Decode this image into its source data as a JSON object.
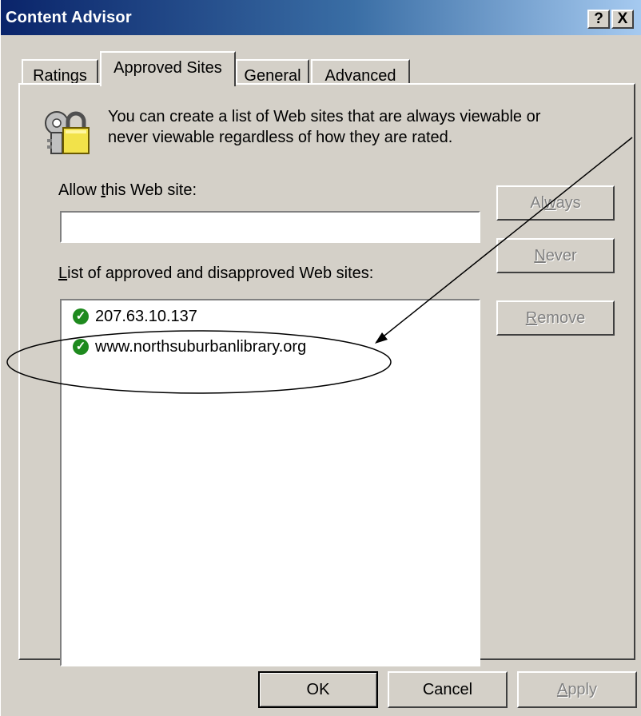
{
  "window": {
    "title": "Content Advisor",
    "help_button": "?",
    "close_button": "X"
  },
  "tabs": [
    {
      "label": "Ratings",
      "selected": false
    },
    {
      "label": "Approved Sites",
      "selected": true
    },
    {
      "label": "General",
      "selected": false
    },
    {
      "label": "Advanced",
      "selected": false
    }
  ],
  "approved": {
    "info_line1": "You can create a list of Web sites that are always viewable or",
    "info_line2": "never viewable regardless of how they are rated.",
    "allow_label_pre": "Allow ",
    "allow_label_key": "t",
    "allow_label_post": "his Web site:",
    "allow_input_value": "",
    "list_label_key": "L",
    "list_label_post": "ist of approved and disapproved Web sites:",
    "sites": [
      {
        "text": "207.63.10.137",
        "status": "approved"
      },
      {
        "text": "www.northsuburbanlibrary.org",
        "status": "approved"
      }
    ],
    "always_key": "w",
    "always_pre": "Al",
    "always_post": "ays",
    "never_key": "N",
    "never_post": "ever",
    "remove_key": "R",
    "remove_post": "emove"
  },
  "footer": {
    "ok_label": "OK",
    "cancel_label": "Cancel",
    "apply_key": "A",
    "apply_post": "pply"
  },
  "colors": {
    "titlebar_start": "#0a246a",
    "titlebar_end": "#a6caf0",
    "face": "#d4d0c8",
    "approved_check": "#1e8a1e",
    "annotation": "#000000"
  },
  "icons": [
    "keys-lock-icon",
    "check-icon",
    "help-icon",
    "close-icon"
  ]
}
